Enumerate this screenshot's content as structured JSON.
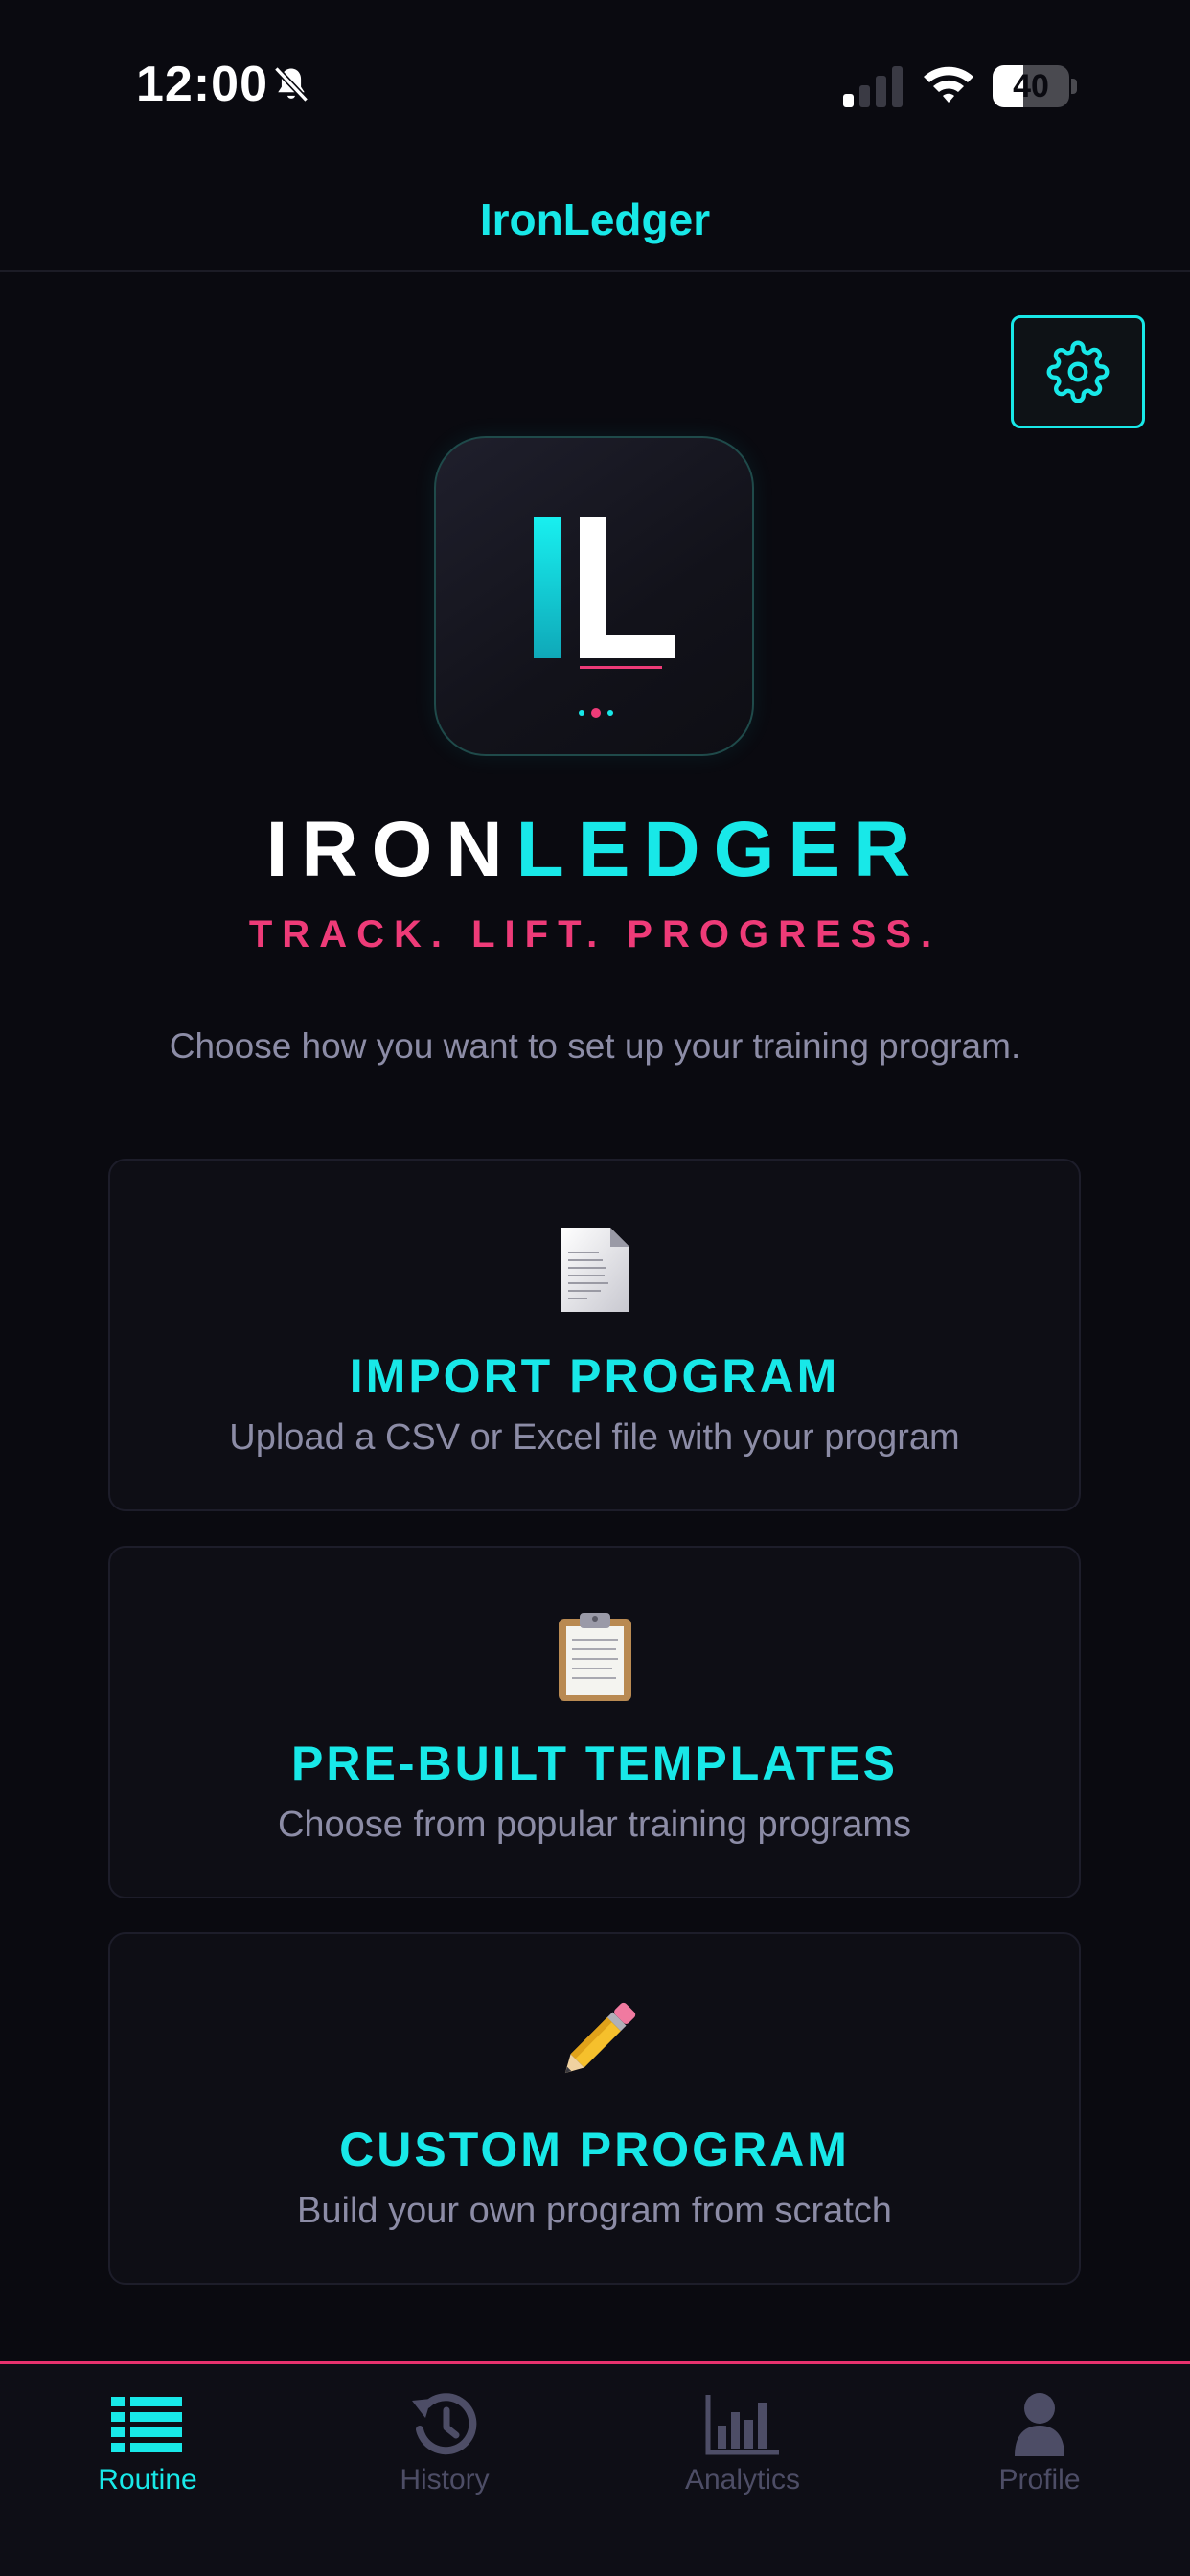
{
  "status_bar": {
    "time": "12:00",
    "battery_level": "40",
    "battery_fraction": 0.4,
    "icons": [
      "bell-slash-icon",
      "cellular-signal-icon",
      "wifi-icon",
      "battery-icon"
    ]
  },
  "header": {
    "title": "IronLedger",
    "settings_icon": "gear-icon"
  },
  "logo": {
    "monogram": "IL",
    "wordmark_iron": "IRON",
    "wordmark_ledger": "LEDGER",
    "tagline": "TRACK. LIFT. PROGRESS."
  },
  "intro": "Choose how you want to set up your training program.",
  "options": [
    {
      "icon": "document-icon",
      "title": "IMPORT PROGRAM",
      "subtitle": "Upload a CSV or Excel file with your program"
    },
    {
      "icon": "clipboard-icon",
      "title": "PRE-BUILT TEMPLATES",
      "subtitle": "Choose from popular training programs"
    },
    {
      "icon": "pencil-icon",
      "title": "CUSTOM PROGRAM",
      "subtitle": "Build your own program from scratch"
    }
  ],
  "tabs": [
    {
      "label": "Routine",
      "icon": "list-icon",
      "active": true
    },
    {
      "label": "History",
      "icon": "history-icon",
      "active": false
    },
    {
      "label": "Analytics",
      "icon": "bar-chart-icon",
      "active": false
    },
    {
      "label": "Profile",
      "icon": "user-icon",
      "active": false
    }
  ],
  "colors": {
    "background": "#0a0a10",
    "accent": "#18e8e8",
    "secondary_accent": "#ee3b78",
    "muted_text": "#8c8ca6",
    "inactive_tab": "#4d4d66"
  }
}
